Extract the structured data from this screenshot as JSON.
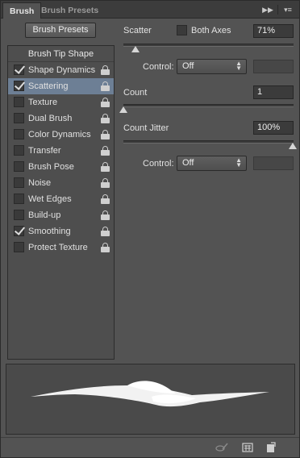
{
  "tabs": {
    "brush": "Brush",
    "brush_presets": "Brush Presets"
  },
  "header_buttons": {
    "forward": "▶▶",
    "menu": "▾≡"
  },
  "presets_button": "Brush Presets",
  "list": {
    "header": "Brush Tip Shape",
    "items": [
      {
        "label": "Shape Dynamics",
        "checked": true,
        "selected": false
      },
      {
        "label": "Scattering",
        "checked": true,
        "selected": true
      },
      {
        "label": "Texture",
        "checked": false,
        "selected": false
      },
      {
        "label": "Dual Brush",
        "checked": false,
        "selected": false
      },
      {
        "label": "Color Dynamics",
        "checked": false,
        "selected": false
      },
      {
        "label": "Transfer",
        "checked": false,
        "selected": false
      },
      {
        "label": "Brush Pose",
        "checked": false,
        "selected": false
      },
      {
        "label": "Noise",
        "checked": false,
        "selected": false
      },
      {
        "label": "Wet Edges",
        "checked": false,
        "selected": false
      },
      {
        "label": "Build-up",
        "checked": false,
        "selected": false
      },
      {
        "label": "Smoothing",
        "checked": true,
        "selected": false
      },
      {
        "label": "Protect Texture",
        "checked": false,
        "selected": false
      }
    ]
  },
  "scatter": {
    "label": "Scatter",
    "both_axes_label": "Both Axes",
    "both_axes_checked": false,
    "value": "71%",
    "control_label": "Control:",
    "control_value": "Off"
  },
  "count": {
    "label": "Count",
    "value": "1"
  },
  "count_jitter": {
    "label": "Count Jitter",
    "value": "100%",
    "control_label": "Control:",
    "control_value": "Off"
  },
  "colors": {
    "panel_bg": "#535353",
    "selected_row": "#6d7f95"
  }
}
